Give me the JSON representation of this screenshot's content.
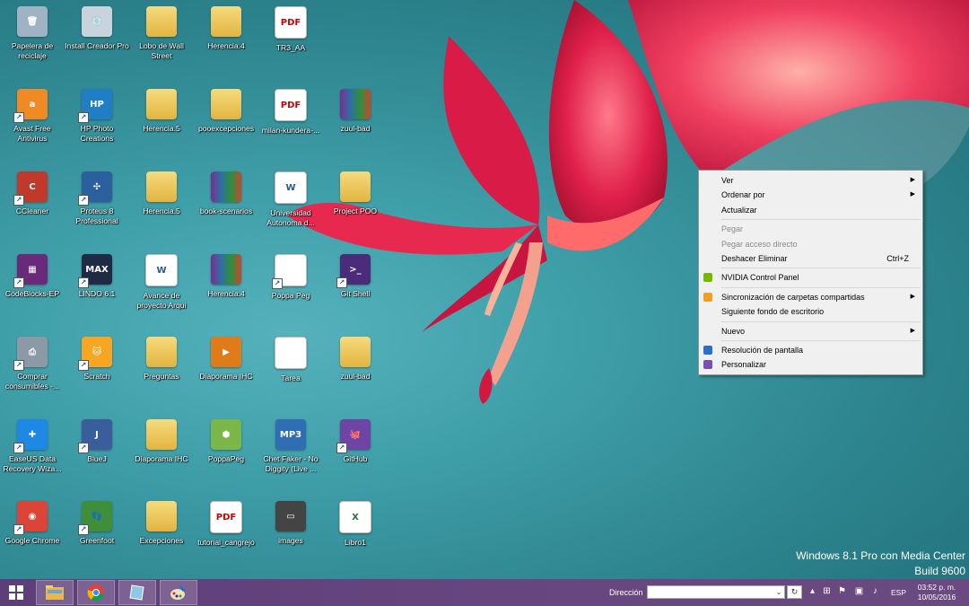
{
  "desktop": {
    "icons": [
      {
        "label": "Papelera de reciclaje",
        "icon": "recycle-bin-icon",
        "col": 0,
        "row": 0,
        "kind": "bin",
        "shortcut": false
      },
      {
        "label": "Install Creador Pro",
        "icon": "cd-installer-icon",
        "col": 1,
        "row": 0,
        "kind": "cd",
        "shortcut": false
      },
      {
        "label": "Lobo de Wall Street",
        "icon": "video-folder-icon",
        "col": 2,
        "row": 0,
        "kind": "folder",
        "shortcut": false
      },
      {
        "label": "Herencia.4",
        "icon": "folder-icon",
        "col": 3,
        "row": 0,
        "kind": "folder",
        "shortcut": false
      },
      {
        "label": "TR3_AA",
        "icon": "pdf-icon",
        "col": 4,
        "row": 0,
        "kind": "doc",
        "shortcut": false
      },
      {
        "label": "Avast Free Antivirus",
        "icon": "avast-icon",
        "col": 0,
        "row": 1,
        "kind": "avast",
        "shortcut": true
      },
      {
        "label": "HP Photo Creations",
        "icon": "hp-photo-icon",
        "col": 1,
        "row": 1,
        "kind": "hp",
        "shortcut": true
      },
      {
        "label": "Herencia.5",
        "icon": "folder-icon",
        "col": 2,
        "row": 1,
        "kind": "folder",
        "shortcut": false
      },
      {
        "label": "pooexcepciones",
        "icon": "folder-icon",
        "col": 3,
        "row": 1,
        "kind": "folder",
        "shortcut": false
      },
      {
        "label": "milan-kundera-...",
        "icon": "pdf-icon",
        "col": 4,
        "row": 1,
        "kind": "doc",
        "shortcut": false
      },
      {
        "label": "zuul-bad",
        "icon": "rar-icon",
        "col": 5,
        "row": 1,
        "kind": "rar",
        "shortcut": false
      },
      {
        "label": "CCleaner",
        "icon": "ccleaner-icon",
        "col": 0,
        "row": 2,
        "kind": "ccleaner",
        "shortcut": true
      },
      {
        "label": "Proteus 8 Professional",
        "icon": "proteus-icon",
        "col": 1,
        "row": 2,
        "kind": "proteus",
        "shortcut": true
      },
      {
        "label": "Herencia.5",
        "icon": "folder-icon",
        "col": 2,
        "row": 2,
        "kind": "folder",
        "shortcut": false
      },
      {
        "label": "book-scenarios",
        "icon": "rar-icon",
        "col": 3,
        "row": 2,
        "kind": "rar",
        "shortcut": false
      },
      {
        "label": "Universidad Autonoma d...",
        "icon": "word-doc-icon",
        "col": 4,
        "row": 2,
        "kind": "word",
        "shortcut": false
      },
      {
        "label": "Project POO",
        "icon": "folder-icon",
        "col": 5,
        "row": 2,
        "kind": "folder",
        "shortcut": false
      },
      {
        "label": "CodeBlocks-EP",
        "icon": "codeblocks-icon",
        "col": 0,
        "row": 3,
        "kind": "codeblocks",
        "shortcut": true
      },
      {
        "label": "LINDO 6.1",
        "icon": "lindo-icon",
        "col": 1,
        "row": 3,
        "kind": "lindo",
        "shortcut": true
      },
      {
        "label": "Avance de proyecto Arqui",
        "icon": "word-doc-icon",
        "col": 2,
        "row": 3,
        "kind": "word",
        "shortcut": false
      },
      {
        "label": "Herencia.4",
        "icon": "rar-icon",
        "col": 3,
        "row": 3,
        "kind": "rar",
        "shortcut": false
      },
      {
        "label": "Poppa Peg",
        "icon": "poppapeg-icon",
        "col": 4,
        "row": 3,
        "kind": "blank",
        "shortcut": true
      },
      {
        "label": "Git Shell",
        "icon": "git-shell-icon",
        "col": 5,
        "row": 3,
        "kind": "gitshell",
        "shortcut": true
      },
      {
        "label": "Comprar consumibles -...",
        "icon": "printer-icon",
        "col": 0,
        "row": 4,
        "kind": "printer",
        "shortcut": true
      },
      {
        "label": "Scratch",
        "icon": "scratch-cat-icon",
        "col": 1,
        "row": 4,
        "kind": "scratch",
        "shortcut": true
      },
      {
        "label": "Preguntas",
        "icon": "folder-icon",
        "col": 2,
        "row": 4,
        "kind": "folder",
        "shortcut": false
      },
      {
        "label": "Diaporama IHC",
        "icon": "slideshow-icon",
        "col": 3,
        "row": 4,
        "kind": "slideshow",
        "shortcut": false
      },
      {
        "label": "Tarea",
        "icon": "text-file-icon",
        "col": 4,
        "row": 4,
        "kind": "blank",
        "shortcut": false
      },
      {
        "label": "zuul-bad",
        "icon": "folder-icon",
        "col": 5,
        "row": 4,
        "kind": "folder",
        "shortcut": false
      },
      {
        "label": "EaseUS Data Recovery Wiza...",
        "icon": "easeus-icon",
        "col": 0,
        "row": 5,
        "kind": "easeus",
        "shortcut": true
      },
      {
        "label": "BlueJ",
        "icon": "bluej-icon",
        "col": 1,
        "row": 5,
        "kind": "bluej",
        "shortcut": true
      },
      {
        "label": "Diaporama IHC",
        "icon": "folder-icon",
        "col": 2,
        "row": 5,
        "kind": "folder",
        "shortcut": false
      },
      {
        "label": "PoppaPeg",
        "icon": "poppapeg-installer-icon",
        "col": 3,
        "row": 5,
        "kind": "installer",
        "shortcut": false
      },
      {
        "label": "Chet Faker - No Diggity (Live ...",
        "icon": "mp3-icon",
        "col": 4,
        "row": 5,
        "kind": "mp3",
        "shortcut": false
      },
      {
        "label": "GitHub",
        "icon": "github-icon",
        "col": 5,
        "row": 5,
        "kind": "github",
        "shortcut": true
      },
      {
        "label": "Google Chrome",
        "icon": "chrome-icon",
        "col": 0,
        "row": 6,
        "kind": "chrome",
        "shortcut": true
      },
      {
        "label": "Greenfoot",
        "icon": "greenfoot-icon",
        "col": 1,
        "row": 6,
        "kind": "greenfoot",
        "shortcut": true
      },
      {
        "label": "Excepciones",
        "icon": "folder-icon",
        "col": 2,
        "row": 6,
        "kind": "folder",
        "shortcut": false
      },
      {
        "label": "tutorial_cangrejo",
        "icon": "pdf-icon",
        "col": 3,
        "row": 6,
        "kind": "doc",
        "shortcut": false
      },
      {
        "label": "images",
        "icon": "images-folder-icon",
        "col": 4,
        "row": 6,
        "kind": "images",
        "shortcut": false
      },
      {
        "label": "Libro1",
        "icon": "excel-icon",
        "col": 5,
        "row": 6,
        "kind": "excel",
        "shortcut": false
      }
    ]
  },
  "context_menu": {
    "items": [
      {
        "label": "Ver",
        "submenu": true
      },
      {
        "label": "Ordenar por",
        "submenu": true
      },
      {
        "label": "Actualizar"
      },
      {
        "separator": true
      },
      {
        "label": "Pegar",
        "disabled": true
      },
      {
        "label": "Pegar acceso directo",
        "disabled": true
      },
      {
        "label": "Deshacer Eliminar",
        "shortcut": "Ctrl+Z"
      },
      {
        "separator": true
      },
      {
        "label": "NVIDIA Control Panel",
        "icon": "nvidia-icon"
      },
      {
        "separator": true
      },
      {
        "label": "Sincronización de carpetas compartidas",
        "icon": "sync-folders-icon",
        "submenu": true
      },
      {
        "label": "Siguiente fondo de escritorio"
      },
      {
        "separator": true
      },
      {
        "label": "Nuevo",
        "submenu": true
      },
      {
        "separator": true
      },
      {
        "label": "Resolución de pantalla",
        "icon": "display-resolution-icon"
      },
      {
        "label": "Personalizar",
        "icon": "personalize-icon"
      }
    ]
  },
  "watermark": {
    "line1": "Windows 8.1 Pro con Media Center",
    "line2": "Build 9600"
  },
  "taskbar": {
    "start_icon": "windows-logo-icon",
    "pinned": [
      {
        "name": "file-explorer-icon"
      },
      {
        "name": "chrome-icon"
      },
      {
        "name": "notebook-app-icon"
      },
      {
        "name": "paint-icon"
      }
    ],
    "address_label": "Dirección",
    "address_value": "",
    "language": "ESP",
    "clock_time": "03:52 p. m.",
    "clock_date": "10/05/2016"
  },
  "colors": {
    "accent": "#674680",
    "menu_bg": "#f0f0f0",
    "wallpaper": "#3f9fa9"
  }
}
